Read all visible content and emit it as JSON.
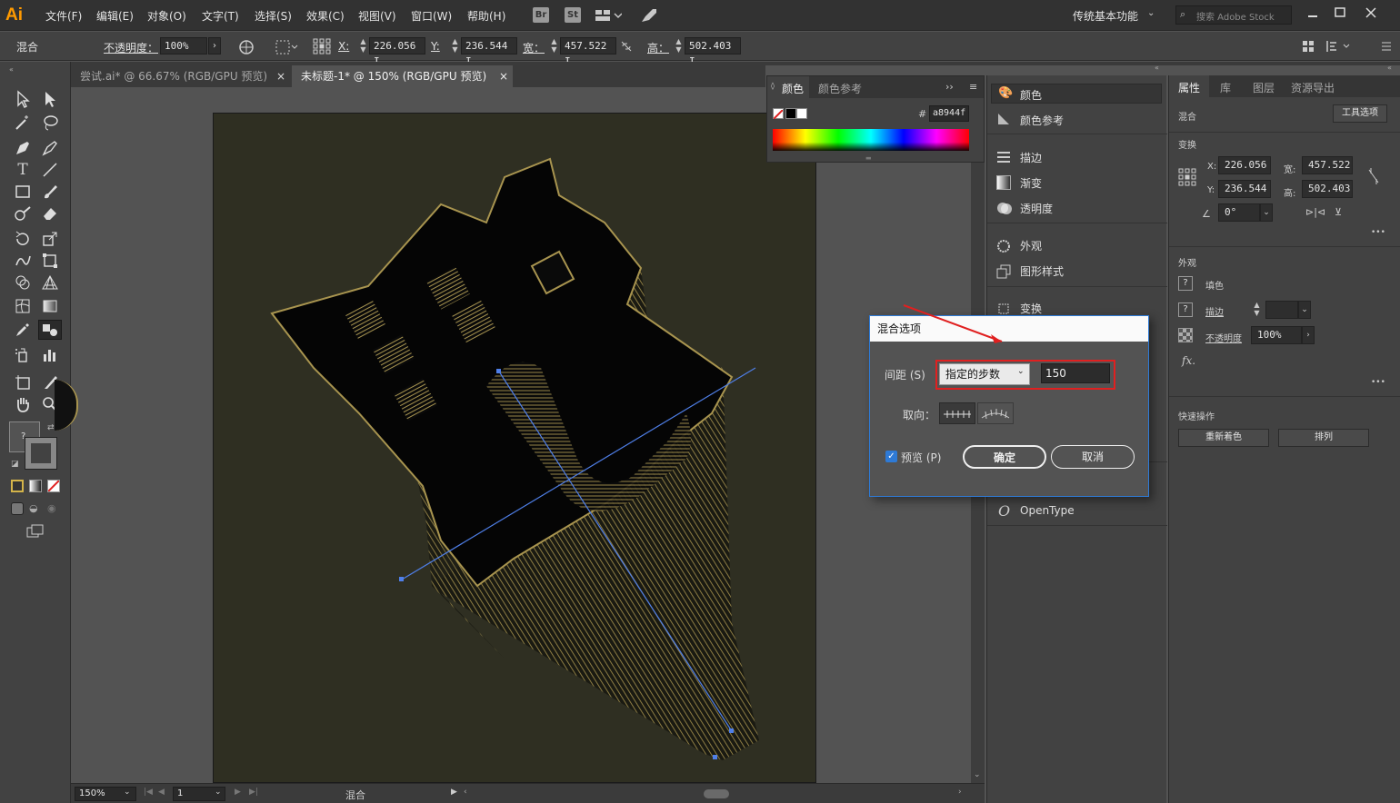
{
  "app": {
    "logo": "Ai"
  },
  "menu": [
    "文件(F)",
    "编辑(E)",
    "对象(O)",
    "文字(T)",
    "选择(S)",
    "效果(C)",
    "视图(V)",
    "窗口(W)",
    "帮助(H)"
  ],
  "menubar": {
    "bridge": "Br",
    "stock": "St",
    "workspace": "传统基本功能",
    "search_placeholder": "搜索 Adobe Stock"
  },
  "control": {
    "mode": "混合",
    "opacity_label": "不透明度：",
    "opacity_value": "100%",
    "x_label": "X:",
    "x_value": "226.056 I",
    "y_label": "Y:",
    "y_value": "236.544 I",
    "w_label": "宽：",
    "w_value": "457.522 I",
    "h_label": "高：",
    "h_value": "502.403 I"
  },
  "tabs": [
    {
      "label": "尝试.ai* @ 66.67% (RGB/GPU 预览)",
      "close": "×"
    },
    {
      "label": "未标题-1* @ 150% (RGB/GPU 预览)",
      "close": "×"
    }
  ],
  "color_panel": {
    "tab_color": "颜色",
    "tab_guide": "颜色参考",
    "hex_prefix": "#",
    "hex": "a8944f"
  },
  "mid_panel": {
    "items": [
      "颜色",
      "颜色参考",
      "描边",
      "渐变",
      "透明度",
      "外观",
      "图形样式",
      "变换",
      "OpenType"
    ]
  },
  "right_panel": {
    "tabs": [
      "属性",
      "库",
      "图层",
      "资源导出"
    ],
    "section_blend": "混合",
    "tool_options": "工具选项",
    "section_transform": "变换",
    "x_label": "X:",
    "x_value": "226.056",
    "w_label": "宽:",
    "w_value": "457.522",
    "y_label": "Y:",
    "y_value": "236.544",
    "h_label": "高:",
    "h_value": "502.403",
    "angle_value": "0°",
    "section_appearance": "外观",
    "fill_label": "填色",
    "stroke_label": "描边",
    "opacity_label": "不透明度",
    "opacity_value": "100%",
    "fx": "fx.",
    "section_quick": "快速操作",
    "recolor": "重新着色",
    "arrange": "排列",
    "more": "•••"
  },
  "dialog": {
    "title": "混合选项",
    "spacing_label": "间距 (S)",
    "spacing_mode": "指定的步数",
    "steps_value": "150",
    "orient_label": "取向：",
    "preview_label": "预览 (P)",
    "preview_checked": true,
    "ok": "确定",
    "cancel": "取消"
  },
  "status": {
    "zoom": "150%",
    "page": "1",
    "info": "混合"
  },
  "colors": {
    "accent_gold": "#a8944f",
    "artboard": "#2f2f22",
    "dialog_border": "#2e7ad6",
    "annotation_red": "#e02020"
  }
}
